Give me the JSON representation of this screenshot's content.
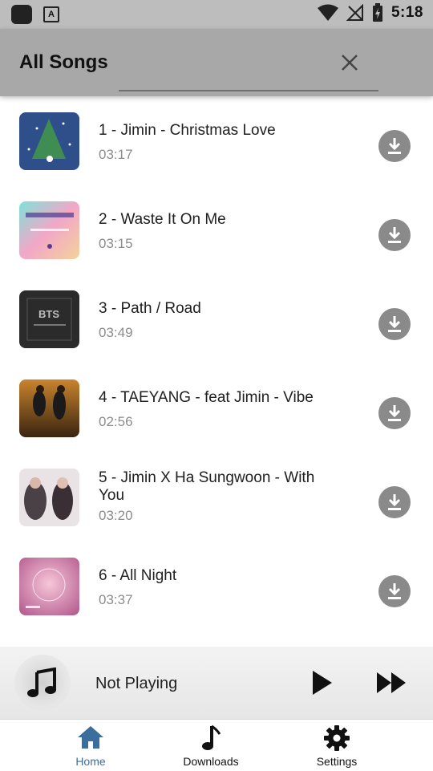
{
  "status_bar": {
    "time": "5:18"
  },
  "app_bar": {
    "title": "All Songs"
  },
  "songs": [
    {
      "title": "1 - Jimin - Christmas Love",
      "duration": "03:17"
    },
    {
      "title": "2 - Waste It On Me",
      "duration": "03:15"
    },
    {
      "title": "3 - Path / Road",
      "duration": "03:49"
    },
    {
      "title": "4 - TAEYANG - feat Jimin - Vibe",
      "duration": "02:56"
    },
    {
      "title": "5 - Jimin X Ha Sungwoon - With You",
      "duration": "03:20"
    },
    {
      "title": "6 - All Night",
      "duration": "03:37"
    }
  ],
  "now_playing": {
    "text": "Not Playing"
  },
  "nav": {
    "home": "Home",
    "downloads": "Downloads",
    "settings": "Settings"
  },
  "colors": {
    "app_bar_bg": "#a8a8a8",
    "download_button": "#8a8a8a",
    "active_nav": "#3b6e9c"
  }
}
